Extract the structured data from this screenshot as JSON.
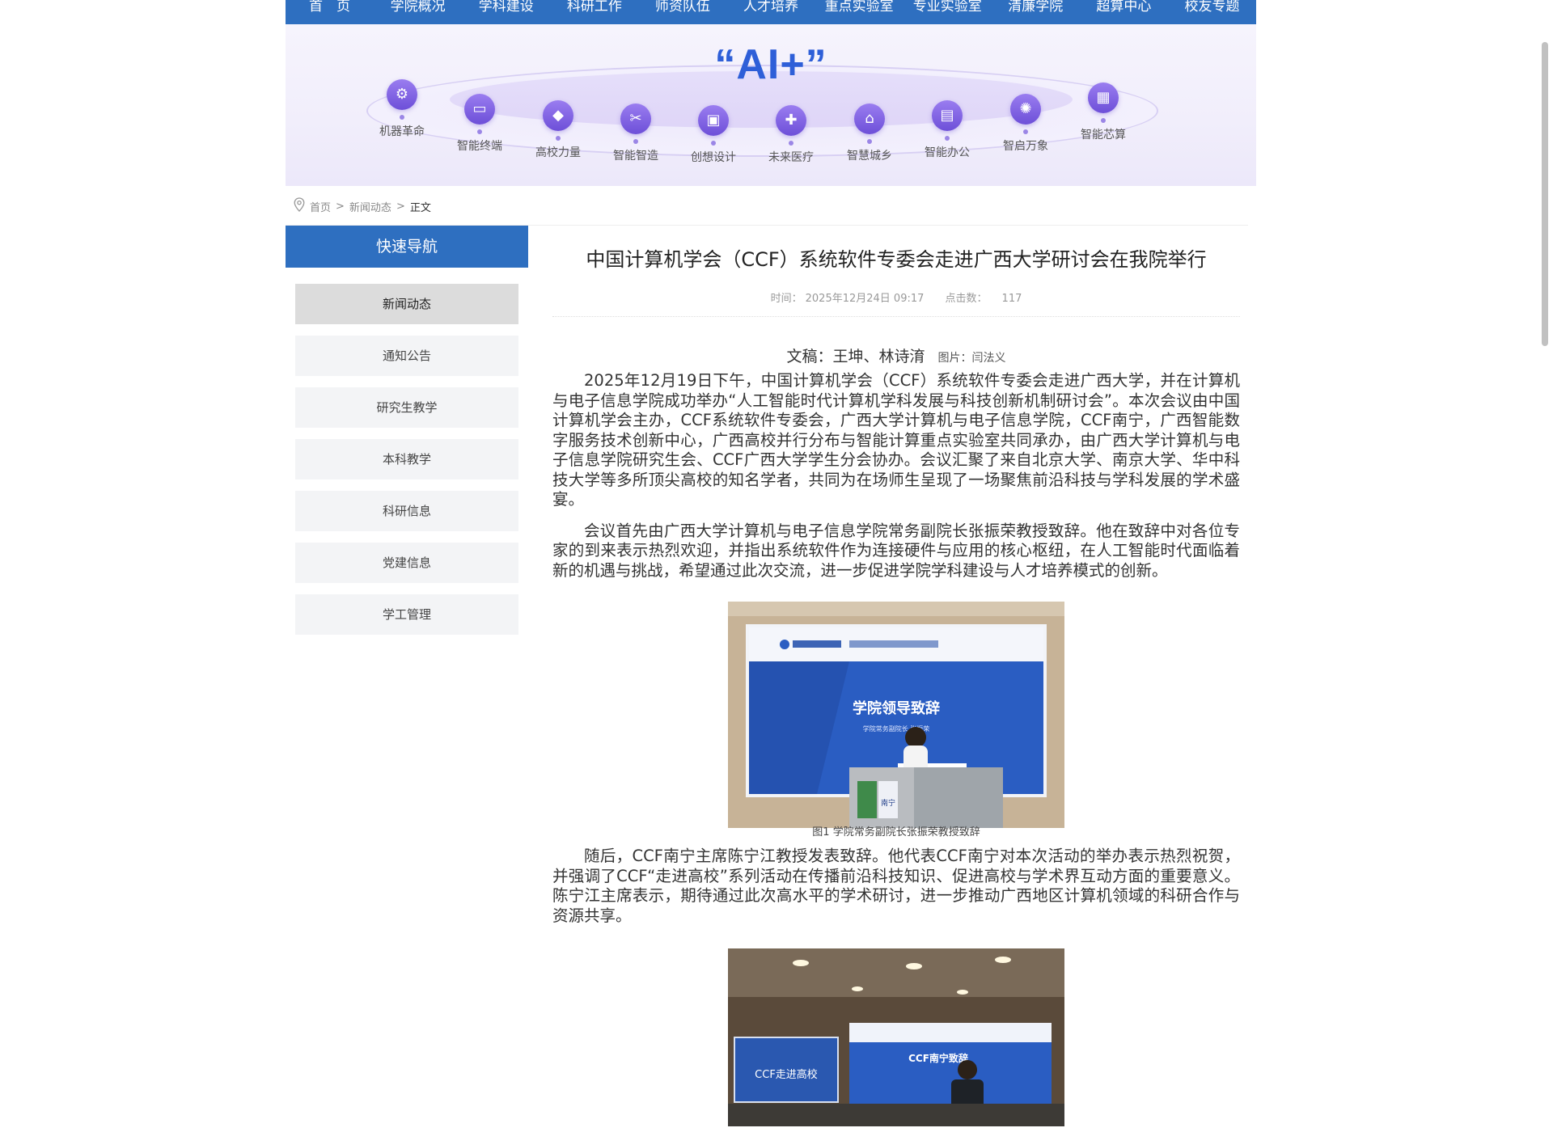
{
  "topnav": [
    "首　页",
    "学院概况",
    "学科建设",
    "科研工作",
    "师资队伍",
    "人才培养",
    "重点实验室",
    "专业实验室",
    "清廉学院",
    "超算中心",
    "校友专题"
  ],
  "banner": {
    "headline": "“AI+”",
    "nodes": [
      "机器革命",
      "智能终端",
      "高校力量",
      "智能智造",
      "创想设计",
      "未来医疗",
      "智慧城乡",
      "智能办公",
      "智启万象",
      "智能芯算"
    ]
  },
  "breadcrumb": {
    "home": "首页",
    "section": "新闻动态",
    "current": "正文"
  },
  "sidebar": {
    "title": "快速导航",
    "items": [
      "新闻动态",
      "通知公告",
      "研究生教学",
      "本科教学",
      "科研信息",
      "党建信息",
      "学工管理"
    ],
    "active_index": 0
  },
  "article": {
    "title": "中国计算机学会（CCF）系统软件专委会走进广西大学研讨会在我院举行",
    "time_label": "时间：",
    "time": "2025年12月24日 09:17",
    "hits_label": "点击数：",
    "hits": "117",
    "byline_writer": "文稿：王坤、林诗淯",
    "byline_photo": "图片：闫法义",
    "para1": "2025年12月19日下午，中国计算机学会（CCF）系统软件专委会走进广西大学，并在计算机与电子信息学院成功举办“人工智能时代计算机学科发展与科技创新机制研讨会”。本次会议由中国计算机学会主办，CCF系统软件专委会，广西大学计算机与电子信息学院，CCF南宁，广西智能数字服务技术创新中心，广西高校并行分布与智能计算重点实验室共同承办，由广西大学计算机与电子信息学院研究生会、CCF广西大学学生分会协办。会议汇聚了来自北京大学、南京大学、华中科技大学等多所顶尖高校的知名学者，共同为在场师生呈现了一场聚焦前沿科技与学科发展的学术盛宴。",
    "para2": "会议首先由广西大学计算机与电子信息学院常务副院长张振荣教授致辞。他在致辞中对各位专家的到来表示热烈欢迎，并指出系统软件作为连接硬件与应用的核心枢纽，在人工智能时代面临着新的机遇与挑战，希望通过此次交流，进一步促进学院学科建设与人才培养模式的创新。",
    "photo1": {
      "screen_title": "学院领导致辞",
      "screen_sub": "学院常务副院长 张振荣",
      "podium_text": "南宁"
    },
    "caption1": "图1 学院常务副院长张振荣教授致辞",
    "para3": "随后，CCF南宁主席陈宁江教授发表致辞。他代表CCF南宁对本次活动的举办表示热烈祝贺，并强调了CCF“走进高校”系列活动在传播前沿科技知识、促进高校与学术界互动方面的重要意义。陈宁江主席表示，期待通过此次高水平的学术研讨，进一步推动广西地区计算机领域的科研合作与资源共享。",
    "photo2": {
      "banner_text": "CCF走进高校",
      "screen_title": "CCF南宁致辞"
    }
  },
  "colors": {
    "primary": "#2e6fc0",
    "accent_purple": "#7b5ce0"
  }
}
